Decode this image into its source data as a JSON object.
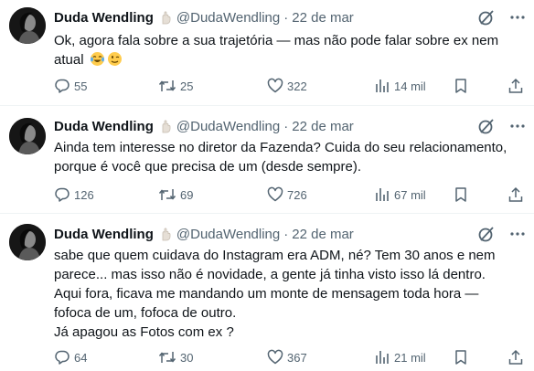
{
  "tweets": [
    {
      "name": "Duda Wendling",
      "handle": "@DudaWendling",
      "date": "22 de mar",
      "lines": [
        "Ok, agora fala sobre a sua trajetória — mas não pode falar sobre ex nem",
        "atual"
      ],
      "emojis": [
        "face-with-tears-of-joy-emoji",
        "winking-face-emoji"
      ],
      "replies": "55",
      "reposts": "25",
      "likes": "322",
      "views": "14 mil"
    },
    {
      "name": "Duda Wendling",
      "handle": "@DudaWendling",
      "date": "22 de mar",
      "lines": [
        "Ainda tem interesse no diretor da Fazenda? Cuida do seu relacionamento,",
        "porque é você que precisa de um (desde sempre)."
      ],
      "replies": "126",
      "reposts": "69",
      "likes": "726",
      "views": "67 mil"
    },
    {
      "name": "Duda Wendling",
      "handle": "@DudaWendling",
      "date": "22 de mar",
      "lines": [
        "sabe que quem cuidava do Instagram era ADM, né? Tem 30 anos e nem",
        "parece... mas isso não é novidade, a gente já tinha visto isso lá dentro.",
        "Aqui fora, ficava me mandando um monte de mensagem toda hora —",
        "fofoca de um, fofoca de outro.",
        "Já apagou as Fotos com ex ?"
      ],
      "replies": "64",
      "reposts": "30",
      "likes": "367",
      "views": "21 mil"
    }
  ],
  "colors": {
    "text": "#0f1419",
    "secondary": "#536471",
    "divider": "#eff3f4"
  }
}
